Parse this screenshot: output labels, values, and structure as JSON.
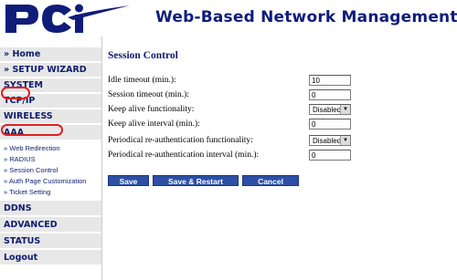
{
  "header": {
    "logo_text": "PCi",
    "title": "Web-Based Network Management"
  },
  "sidebar": {
    "items": [
      {
        "label": "» Home"
      },
      {
        "label": "» SETUP WIZARD"
      },
      {
        "label": "SYSTEM"
      },
      {
        "label": "TCP/IP"
      },
      {
        "label": "WIRELESS"
      },
      {
        "label": "AAA"
      }
    ],
    "sub_items": [
      {
        "label": "» Web Redirection"
      },
      {
        "label": "» RADIUS"
      },
      {
        "label": "» Session Control"
      },
      {
        "label": "» Auth Page Customization"
      },
      {
        "label": "» Ticket Setting"
      }
    ],
    "items_after": [
      {
        "label": "DDNS"
      },
      {
        "label": "ADVANCED"
      },
      {
        "label": "STATUS"
      },
      {
        "label": "Logout"
      }
    ]
  },
  "main": {
    "title": "Session Control",
    "fields": [
      {
        "label": "Idle timeout (min.):",
        "value": "10"
      },
      {
        "label": "Session timeout (min.):",
        "value": "0"
      },
      {
        "label": "Keep alive functionality:",
        "value": "Disabled"
      },
      {
        "label": "Keep alive interval (min.):",
        "value": "0"
      },
      {
        "label": "Periodical re-authentication functionality:",
        "value": "Disabled"
      },
      {
        "label": "Periodical re-authentication interval (min.):",
        "value": "0"
      }
    ],
    "buttons": {
      "save": "Save",
      "save_restart": "Save & Restart",
      "cancel": "Cancel"
    }
  },
  "colors": {
    "brand_navy": "#0f1d7a",
    "nav_bg": "#e7e7e7",
    "button_blue": "#2d4fa5",
    "highlight_red": "#e02020"
  }
}
